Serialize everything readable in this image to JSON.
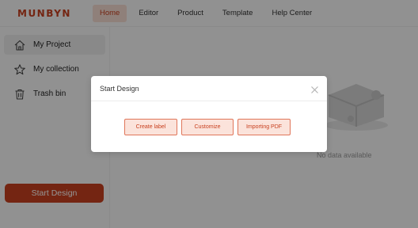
{
  "brand": {
    "logo": "MUNBYN",
    "accent": "#c8401f"
  },
  "nav": {
    "items": [
      {
        "label": "Home",
        "active": true
      },
      {
        "label": "Editor",
        "active": false
      },
      {
        "label": "Product",
        "active": false
      },
      {
        "label": "Template",
        "active": false
      },
      {
        "label": "Help Center",
        "active": false
      }
    ]
  },
  "sidebar": {
    "items": [
      {
        "label": "My Project",
        "icon": "home-icon",
        "active": true
      },
      {
        "label": "My collection",
        "icon": "star-icon",
        "active": false
      },
      {
        "label": "Trash bin",
        "icon": "trash-icon",
        "active": false
      }
    ],
    "start_button": "Start Design"
  },
  "main": {
    "empty_text": "No data available"
  },
  "modal": {
    "title": "Start Design",
    "close_icon": "close-icon",
    "actions": [
      "Create label",
      "Customize",
      "Importing PDF"
    ]
  }
}
